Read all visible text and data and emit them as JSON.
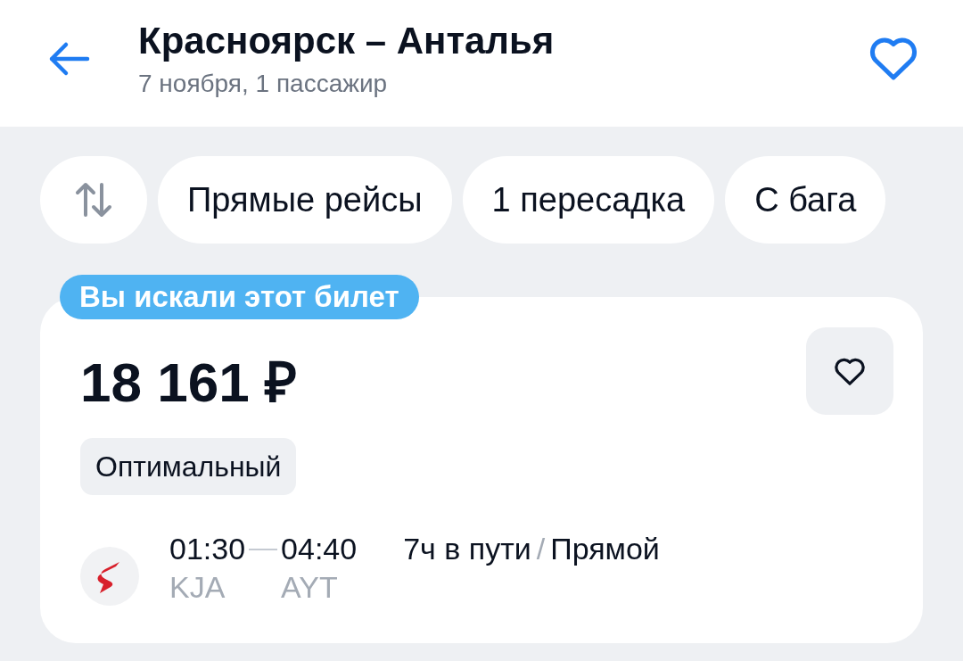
{
  "header": {
    "title": "Красноярск – Анталья",
    "subtitle": "7 ноября, 1 пассажир",
    "favorite": false
  },
  "filters": [
    {
      "label": "Прямые рейсы",
      "selected": false
    },
    {
      "label": "1 пересадка",
      "selected": false
    },
    {
      "label": "С бага",
      "selected": false
    }
  ],
  "ticket": {
    "badge": "Вы искали этот билет",
    "price": "18 161 ₽",
    "favorite": false,
    "tag": "Оптимальный",
    "departure_time": "01:30",
    "arrival_time": "04:40",
    "departure_code": "KJA",
    "arrival_code": "AYT",
    "duration": "7ч в пути",
    "separator": "/",
    "route_type": "Прямой"
  }
}
